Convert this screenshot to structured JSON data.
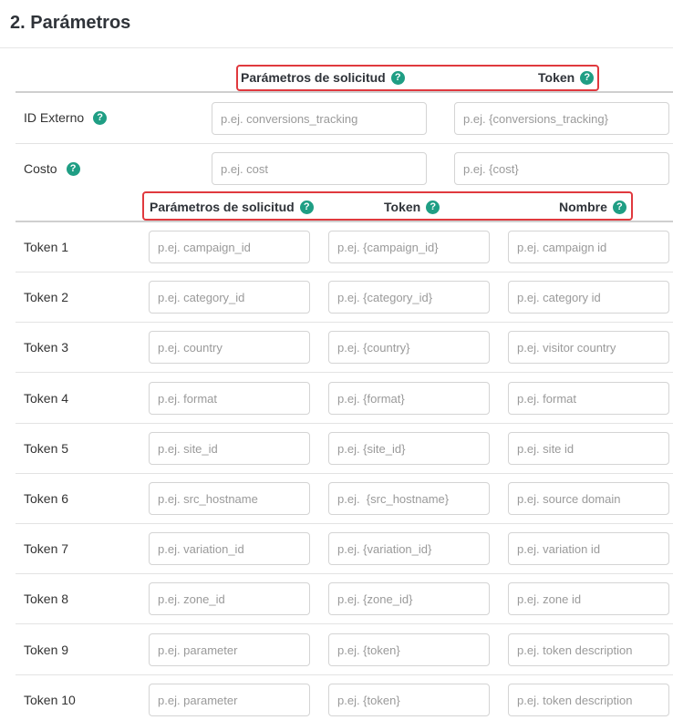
{
  "section": {
    "title": "2. Parámetros"
  },
  "header1": {
    "param_label": "Parámetros de solicitud",
    "token_label": "Token",
    "help": "?"
  },
  "header2": {
    "param_label": "Parámetros de solicitud",
    "token_label": "Token",
    "name_label": "Nombre",
    "help": "?"
  },
  "external_id": {
    "label": "ID Externo",
    "param_placeholder": "p.ej. conversions_tracking",
    "token_placeholder": "p.ej. {conversions_tracking}"
  },
  "cost": {
    "label": "Costo",
    "param_placeholder": "p.ej. cost",
    "token_placeholder": "p.ej. {cost}"
  },
  "tokens": [
    {
      "label": "Token 1",
      "param": "p.ej. campaign_id",
      "token": "p.ej. {campaign_id}",
      "name": "p.ej. campaign id"
    },
    {
      "label": "Token 2",
      "param": "p.ej. category_id",
      "token": "p.ej. {category_id}",
      "name": "p.ej. category id"
    },
    {
      "label": "Token 3",
      "param": "p.ej. country",
      "token": "p.ej. {country}",
      "name": "p.ej. visitor country"
    },
    {
      "label": "Token 4",
      "param": "p.ej. format",
      "token": "p.ej. {format}",
      "name": "p.ej. format"
    },
    {
      "label": "Token 5",
      "param": "p.ej. site_id",
      "token": "p.ej. {site_id}",
      "name": "p.ej. site id"
    },
    {
      "label": "Token 6",
      "param": "p.ej. src_hostname",
      "token": "p.ej.  {src_hostname}",
      "name": "p.ej. source domain"
    },
    {
      "label": "Token 7",
      "param": "p.ej. variation_id",
      "token": "p.ej. {variation_id}",
      "name": "p.ej. variation id"
    },
    {
      "label": "Token 8",
      "param": "p.ej. zone_id",
      "token": "p.ej. {zone_id}",
      "name": "p.ej. zone id"
    },
    {
      "label": "Token 9",
      "param": "p.ej. parameter",
      "token": "p.ej. {token}",
      "name": "p.ej. token description"
    },
    {
      "label": "Token 10",
      "param": "p.ej. parameter",
      "token": "p.ej. {token}",
      "name": "p.ej. token description"
    }
  ]
}
